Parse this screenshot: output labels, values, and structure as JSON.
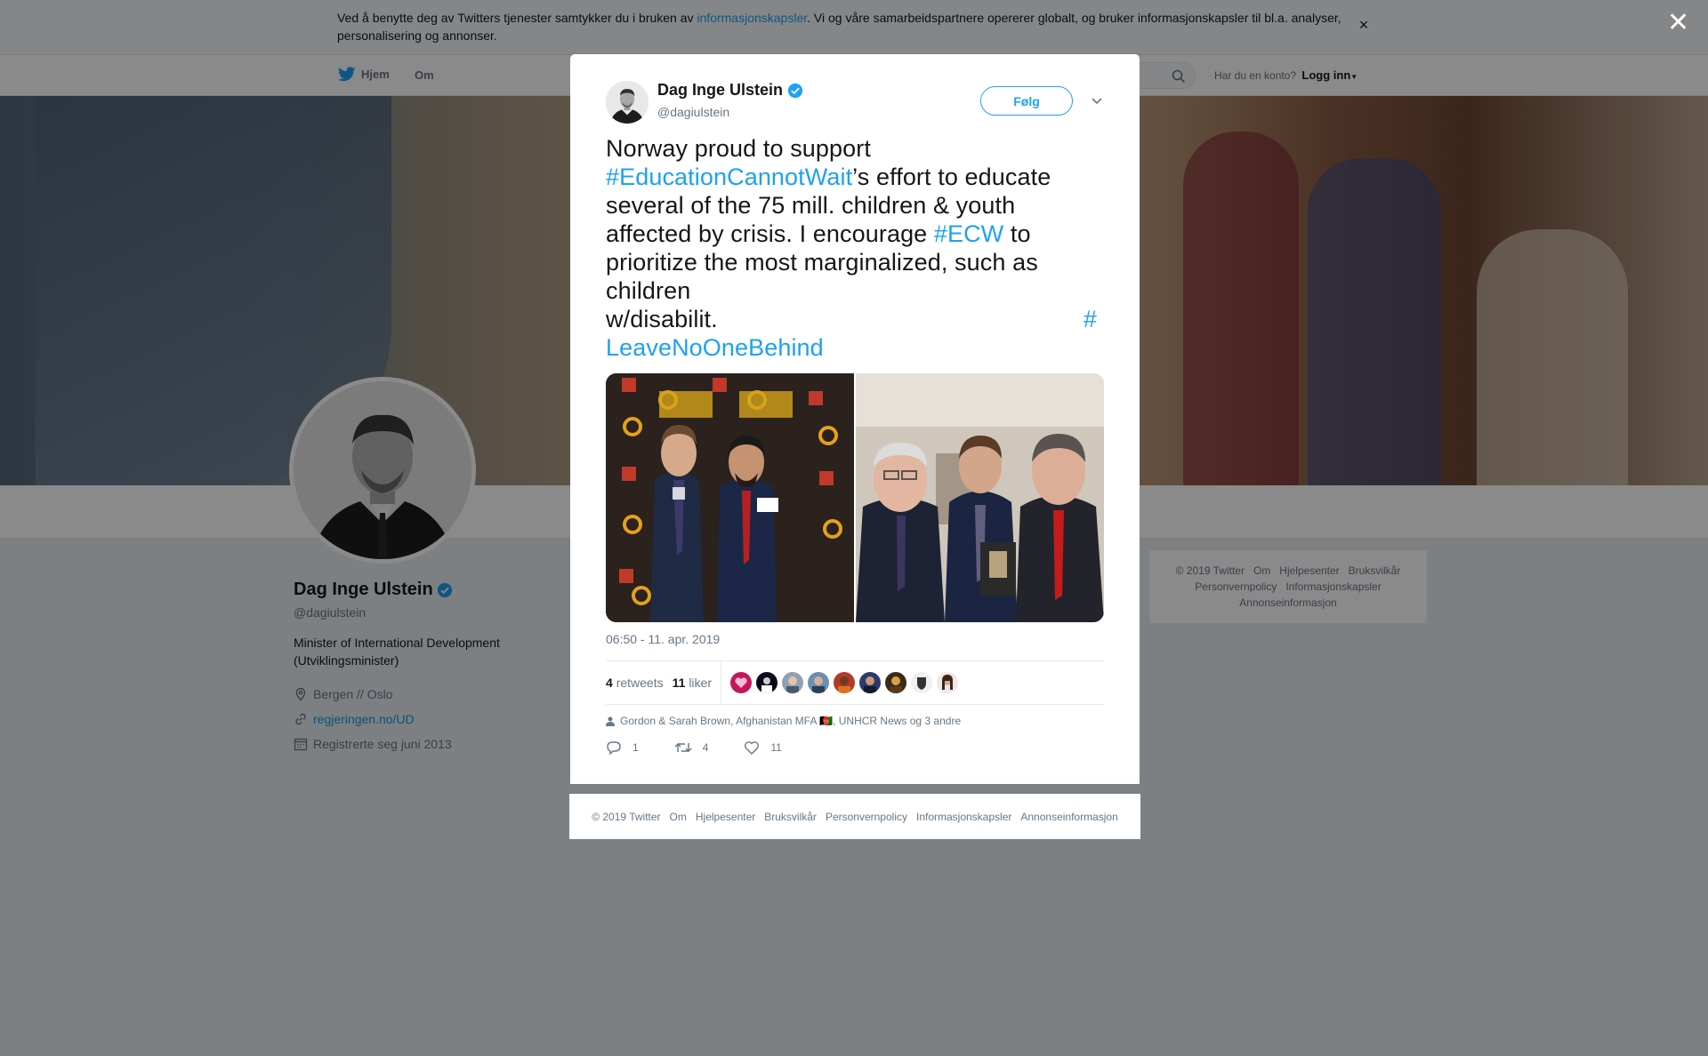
{
  "cookie_bar": {
    "text_before": "Ved å benytte deg av Twitters tjenester samtykker du i bruken av ",
    "link": "informasjonskapsler",
    "text_after": ". Vi og våre samarbeidspartnere opererer globalt, og bruker informasjonskapsler til bl.a. analyser, personalisering og annonser.",
    "close": "×"
  },
  "nav": {
    "home": "Hjem",
    "about": "Om",
    "account_prompt": "Har du en konto?",
    "login": "Logg inn"
  },
  "profile": {
    "name": "Dag Inge Ulstein",
    "handle": "@dagiulstein",
    "bio": "Minister of International Development (Utviklingsminister)",
    "location": "Bergen // Oslo",
    "website": "regjeringen.no/UD",
    "joined": "Registrerte seg juni 2013"
  },
  "side_footer": {
    "links": [
      "© 2019 Twitter",
      "Om",
      "Hjelpesenter",
      "Bruksvilkår",
      "Personvernpolicy",
      "Informasjonskapsler",
      "Annonseinformasjon"
    ]
  },
  "tweet": {
    "name": "Dag Inge Ulstein",
    "handle": "@dagiulstein",
    "follow": "Følg",
    "text": {
      "l1": "Norway proud to support",
      "l2_tag": "#EducationCannotWait",
      "l2_rest": "’s effort to educate",
      "l3": "several of the 75 mill. children & youth",
      "l4_start": "affected by crisis. I encourage ",
      "l4_tag": "#ECW",
      "l4_end": " to",
      "l5": "prioritize the most marginalized, such as",
      "l6": "children",
      "l7": "w/disabilit.",
      "l7_tag": "#",
      "l8_tag": "LeaveNoOneBehind"
    },
    "timestamp": "06:50 - 11. apr. 2019",
    "retweets_count": "4",
    "retweets_label": "retweets",
    "likes_count": "11",
    "likes_label": "liker",
    "liked_by": "Gordon & Sarah Brown, Afghanistan MFA 🇦🇫, UNHCR News og 3 andre",
    "replies": "1",
    "retweets": "4",
    "likes": "11"
  },
  "modal_footer": {
    "links": [
      "© 2019 Twitter",
      "Om",
      "Hjelpesenter",
      "Bruksvilkår",
      "Personvernpolicy",
      "Informasjonskapsler",
      "Annonseinformasjon"
    ]
  },
  "colors": {
    "accent": "#1da1f2",
    "text": "#14171a",
    "muted": "#657786",
    "background": "#e6ecf0"
  },
  "icons": [
    "twitter-bird-icon",
    "search-icon",
    "verified-icon",
    "chevron-down-icon",
    "location-icon",
    "link-icon",
    "calendar-icon",
    "person-icon",
    "reply-icon",
    "retweet-icon",
    "heart-icon",
    "close-icon"
  ]
}
